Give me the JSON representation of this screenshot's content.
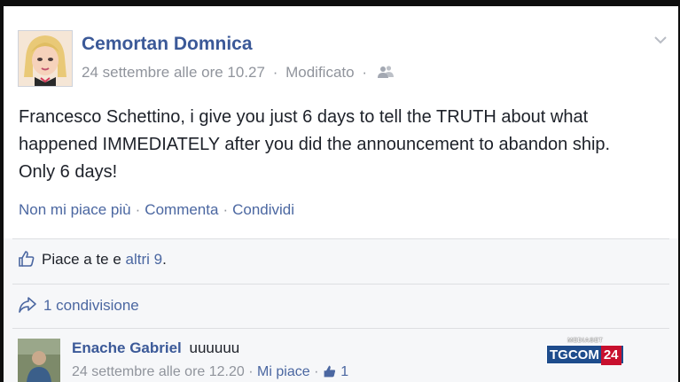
{
  "post": {
    "author": "Cemortan Domnica",
    "timestamp": "24 settembre alle ore 10.27",
    "edited": "Modificato",
    "separator": "·",
    "audience_icon": "friends-icon",
    "menu_icon": "chevron-down-icon",
    "text_lines": [
      "Francesco Schettino, i give you just 6 days to tell the TRUTH about what",
      "happened IMMEDIATELY after you did the announcement to abandon ship.",
      "Only 6 days!"
    ],
    "actions": {
      "unlike": "Non mi piace più",
      "comment": "Commenta",
      "share": "Condividi"
    }
  },
  "likes": {
    "icon": "thumbs-up-icon",
    "prefix": "Piace a te e",
    "others_link": "altri 9",
    "suffix": "."
  },
  "shares": {
    "icon": "share-arrow-icon",
    "label": "1 condivisione"
  },
  "comment": {
    "author": "Enache Gabriel",
    "text": "uuuuuu",
    "timestamp": "24 settembre alle ore 12.20",
    "like_link": "Mi piace",
    "like_count": "1"
  },
  "watermark": {
    "top": "MEDIASET",
    "brand": "TGCOM",
    "number": "24"
  },
  "colors": {
    "link": "#4b67a1",
    "author": "#3b5998",
    "meta": "#90949c",
    "brand_blue": "#1e4c8c",
    "brand_red": "#c8102e"
  }
}
